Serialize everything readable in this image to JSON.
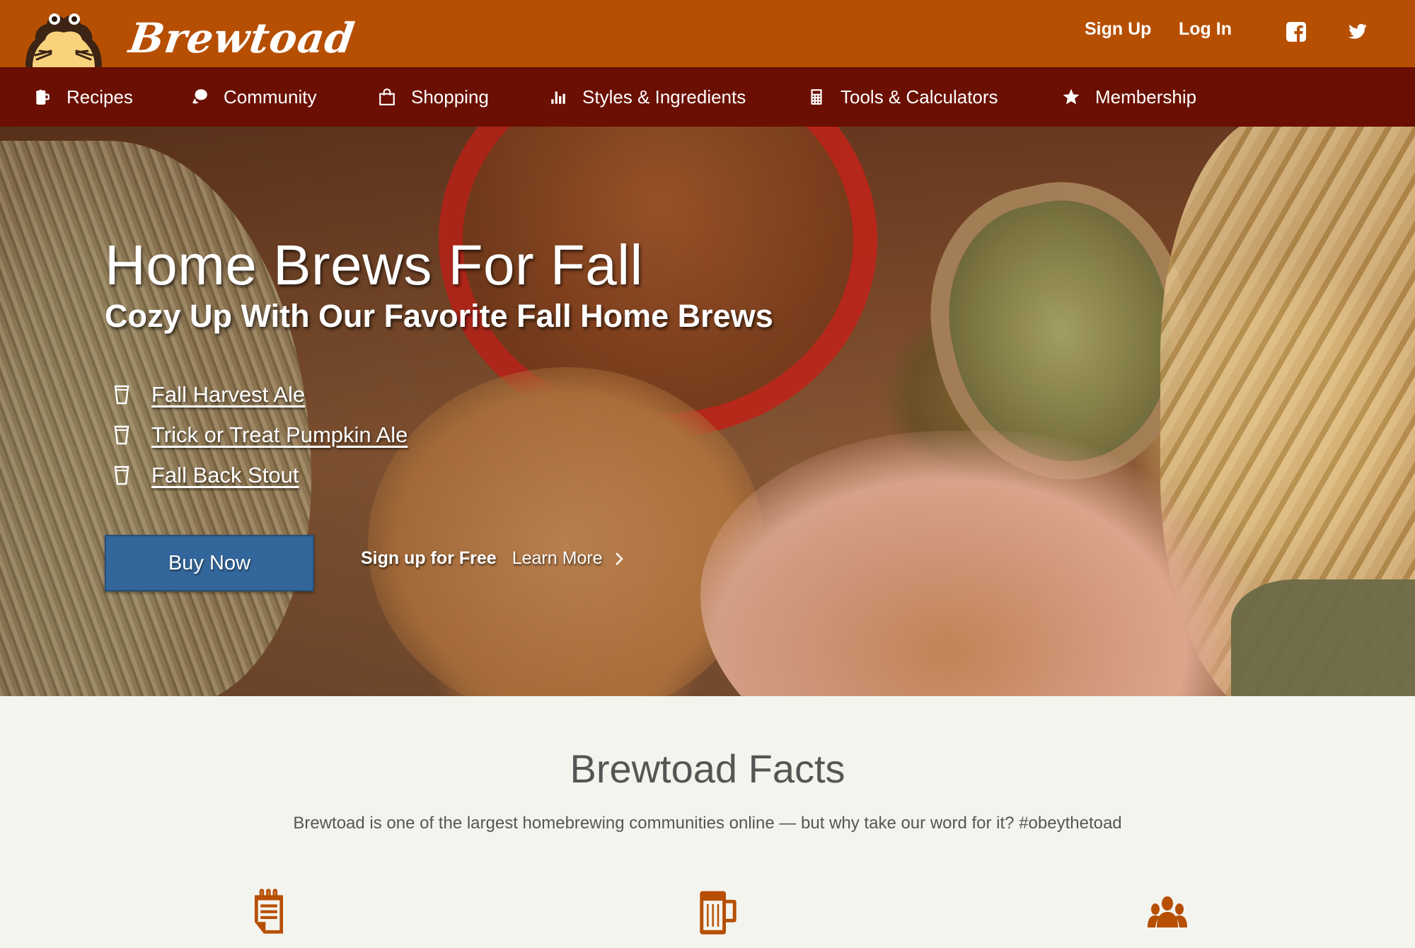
{
  "header": {
    "brand": "Brewtoad",
    "sign_up": "Sign Up",
    "log_in": "Log In",
    "social": [
      {
        "name": "facebook",
        "icon": "facebook-icon"
      },
      {
        "name": "twitter",
        "icon": "twitter-icon"
      }
    ]
  },
  "nav": {
    "items": [
      {
        "label": "Recipes",
        "icon": "beer-mug-icon"
      },
      {
        "label": "Community",
        "icon": "chat-bubbles-icon"
      },
      {
        "label": "Shopping",
        "icon": "shopping-bag-icon"
      },
      {
        "label": "Styles & Ingredients",
        "icon": "bar-chart-icon"
      },
      {
        "label": "Tools & Calculators",
        "icon": "calculator-icon"
      },
      {
        "label": "Membership",
        "icon": "star-icon"
      }
    ]
  },
  "hero": {
    "title": "Home Brews For Fall",
    "subtitle": "Cozy Up With Our Favorite Fall Home Brews",
    "brews": [
      {
        "label": "Fall Harvest Ale",
        "icon": "pint-glass-icon"
      },
      {
        "label": "Trick or Treat Pumpkin Ale",
        "icon": "pint-glass-icon"
      },
      {
        "label": "Fall Back Stout",
        "icon": "pint-glass-icon"
      }
    ],
    "buy_now": "Buy Now",
    "sign_up_free": "Sign up for Free",
    "learn_more": "Learn More"
  },
  "facts": {
    "title": "Brewtoad Facts",
    "description": "Brewtoad is one of the largest homebrewing communities online — but why take our word for it? #obeythetoad",
    "icons": [
      "notepad-icon",
      "beer-mug-icon",
      "people-group-icon"
    ]
  },
  "colors": {
    "header_bg": "#b64f02",
    "nav_bg": "#6a0f01",
    "button_blue": "#33669a",
    "facts_bg": "#f4f4ef",
    "icon_orange": "#b64f02"
  }
}
